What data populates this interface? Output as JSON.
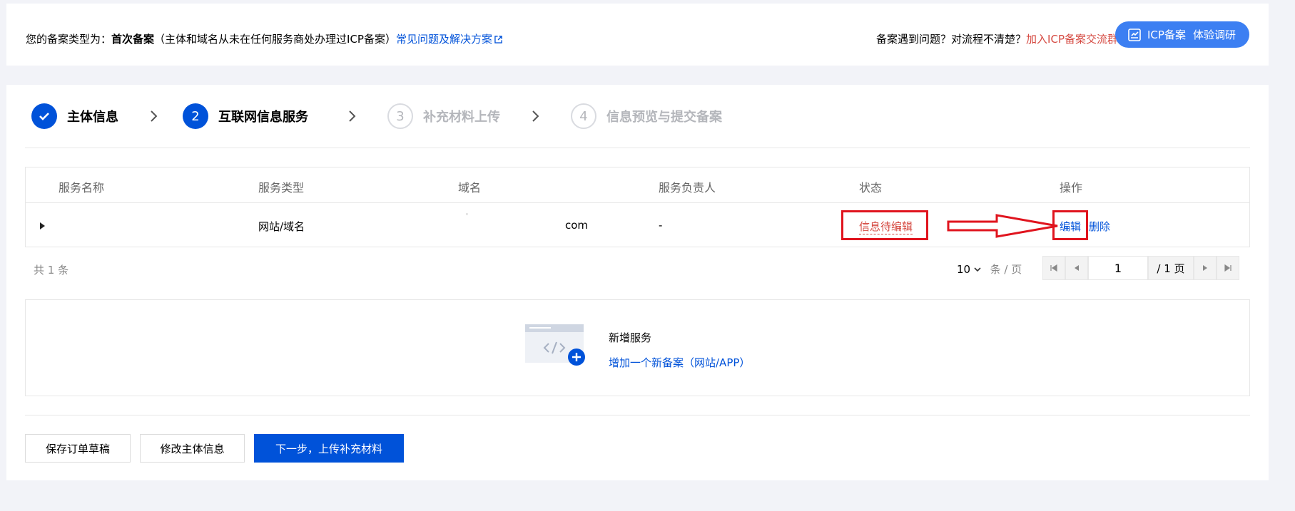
{
  "banner": {
    "type_prefix": "您的备案类型为：",
    "type_value": "首次备案",
    "type_desc": "（主体和域名从未在任何服务商处办理过ICP备案）",
    "faq_link": "常见问题及解决方案",
    "help_prefix": "备案遇到问题？对流程不清楚？",
    "help_link": "加入ICP备案交流群",
    "icp_button": "ICP备案",
    "survey_button": "体验调研"
  },
  "steps": [
    {
      "num": "",
      "label": "主体信息",
      "state": "done"
    },
    {
      "num": "2",
      "label": "互联网信息服务",
      "state": "active"
    },
    {
      "num": "3",
      "label": "补充材料上传",
      "state": "todo"
    },
    {
      "num": "4",
      "label": "信息预览与提交备案",
      "state": "todo"
    }
  ],
  "table": {
    "headers": [
      "服务名称",
      "服务类型",
      "域名",
      "服务负责人",
      "状态",
      "操作"
    ],
    "rows": [
      {
        "name": "",
        "type": "网站/域名",
        "domain_mark": "'",
        "domain": "com",
        "owner": "-",
        "status": "信息待编辑",
        "edit": "编辑",
        "delete": "删除"
      }
    ]
  },
  "pagination": {
    "total": "共 1 条",
    "page_size": "10",
    "page_size_unit": "条 / 页",
    "current_page": "1",
    "total_pages": "/ 1 页"
  },
  "add_service": {
    "title": "新增服务",
    "link": "增加一个新备案（网站/APP）"
  },
  "actions": {
    "save_draft": "保存订单草稿",
    "modify_subject": "修改主体信息",
    "next": "下一步，上传补充材料"
  },
  "colors": {
    "primary": "#0052d9",
    "danger": "#d54941",
    "annotation": "#e0141e"
  }
}
